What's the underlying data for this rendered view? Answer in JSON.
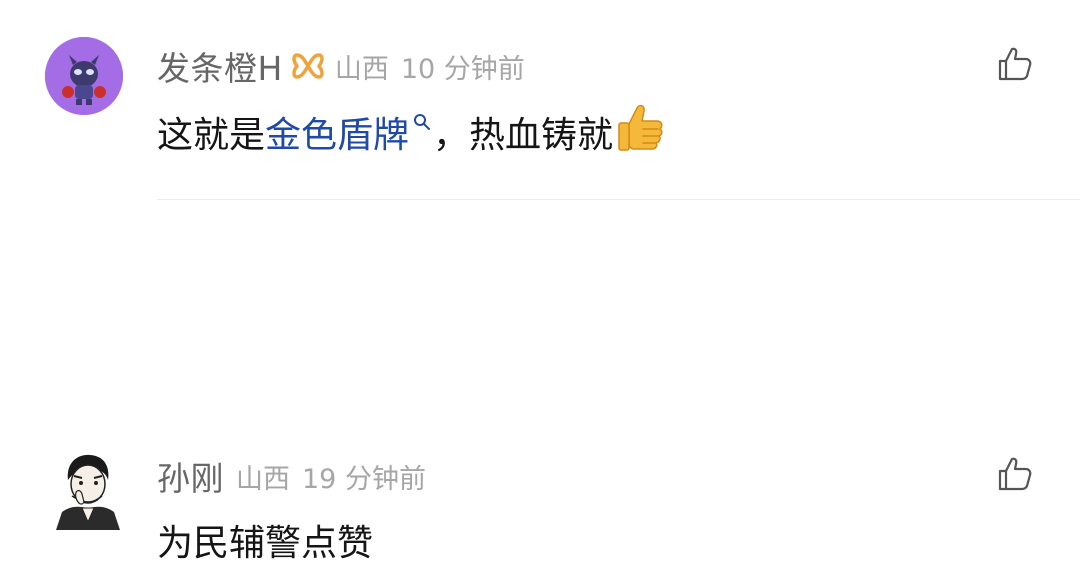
{
  "comments": [
    {
      "username": "发条橙H",
      "location": "山西",
      "time": "10 分钟前",
      "text_before": "这就是",
      "link_text": "金色盾牌",
      "text_after": "，热血铸就",
      "badge_icon": "vip-badge-icon",
      "emoji": "thumbs-up-emoji",
      "like_icon": "thumbs-up-outline-icon",
      "avatar_color": "#a46de6"
    },
    {
      "username": "孙刚",
      "location": "山西",
      "time": "19 分钟前",
      "text": "为民辅警点赞",
      "like_icon": "thumbs-up-outline-icon"
    }
  ],
  "colors": {
    "link": "#1f4aa8",
    "meta": "#a6a6a6",
    "username": "#666666",
    "badge": "#f0a33a"
  }
}
